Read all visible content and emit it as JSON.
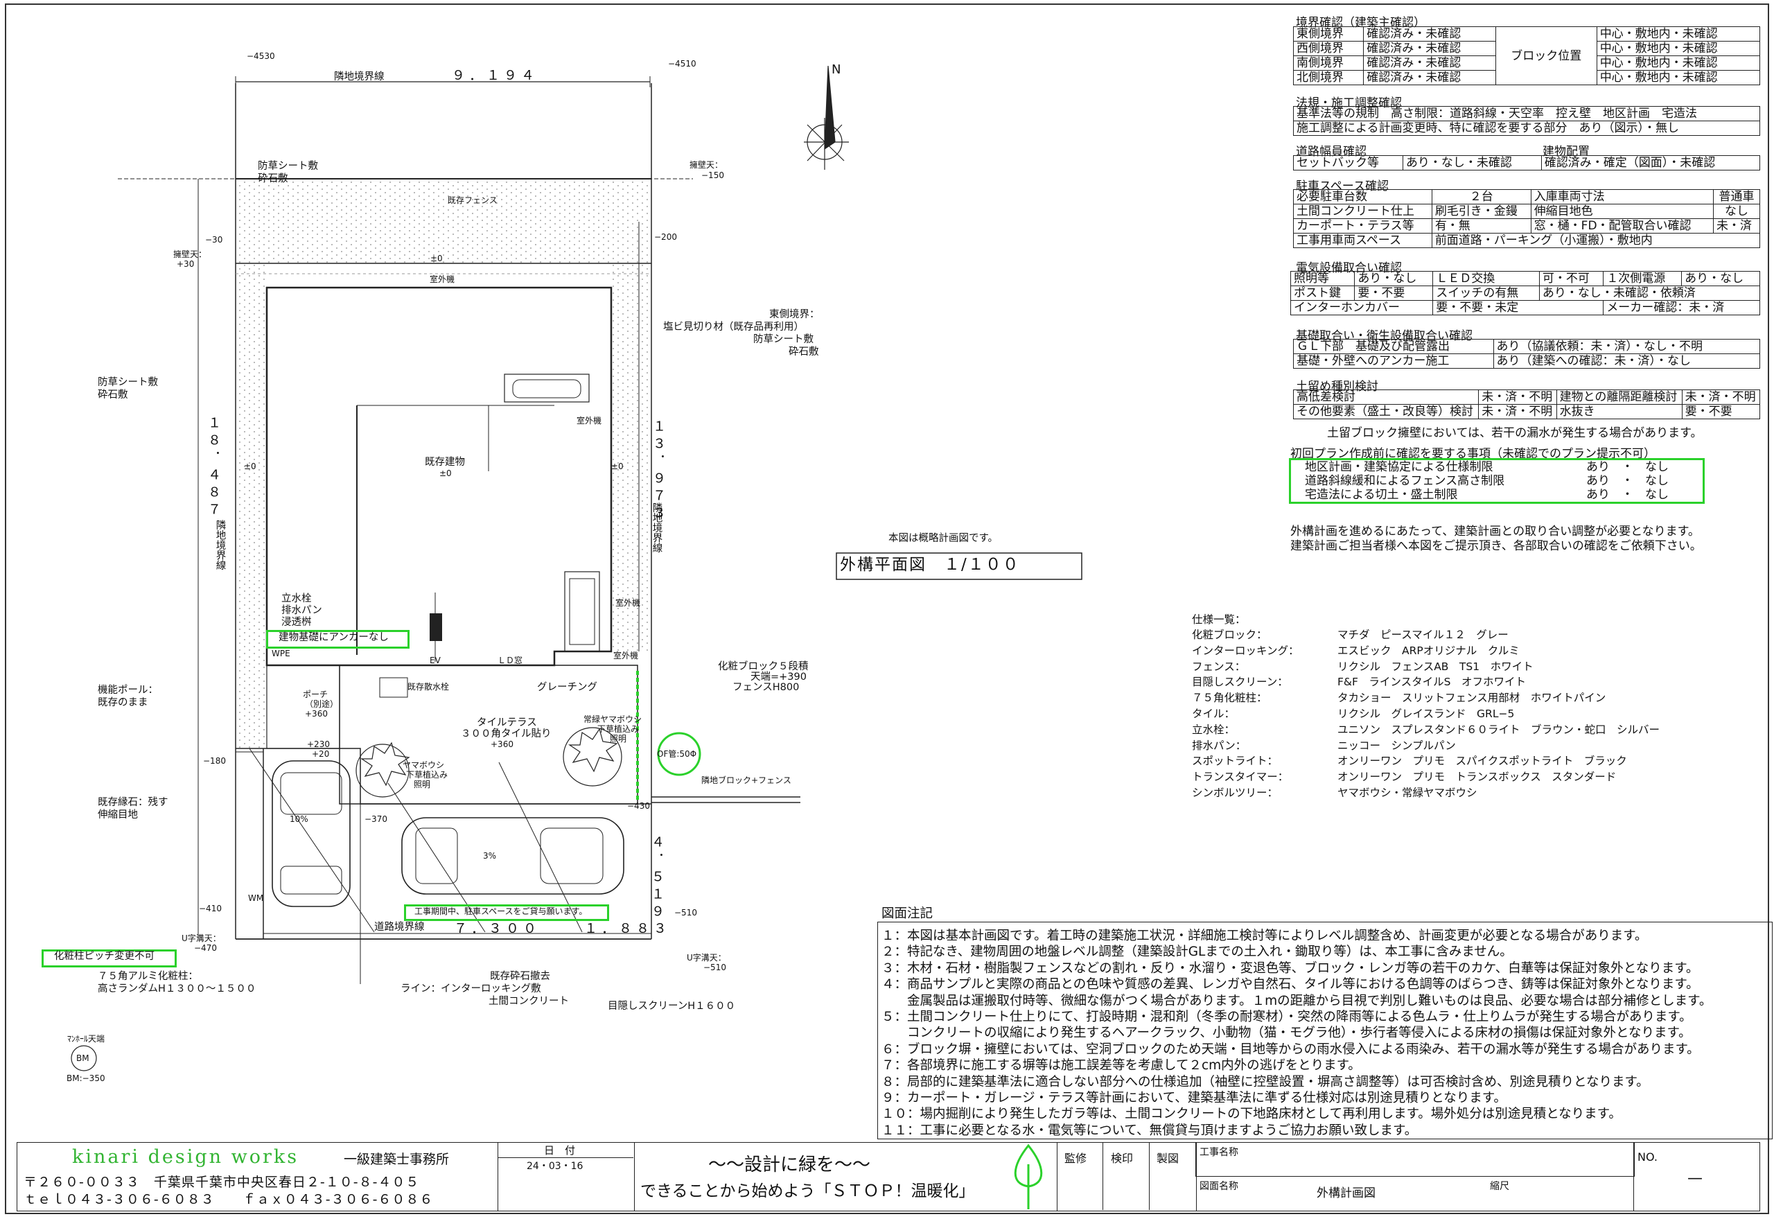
{
  "plan": {
    "top_left_level": "−4530",
    "top_right_level": "−4510",
    "north_label": "N",
    "top_boundary": "隣地境界線",
    "top_dim": "９．１９４",
    "gravel_top": [
      "防草シート敷",
      "砕石敷"
    ],
    "wall_label": [
      "擁壁天：",
      "−150"
    ],
    "existing_fence": "既存フェンス",
    "level_m30": "−30",
    "retaining_left": [
      "擁壁天：",
      "+30"
    ],
    "level_m200": "−200",
    "level_pm0": "±0",
    "outdoor_unit": "室外機",
    "east_boundary": [
      "東側境界：",
      "塩ビ見切り材（既存品再利用）",
      "防草シート敷",
      "砕石敷"
    ],
    "gravel_left": [
      "防草シート敷",
      "砕石敷"
    ],
    "left_dim": "１８．４８７",
    "right_dim": "１３．９７３",
    "left_boundary": "隣地境界線",
    "right_boundary": "隣地境界線",
    "house_name": "既存建物",
    "house_level": "±0",
    "water_tap": [
      "立水栓",
      "排水パン",
      "浸透桝"
    ],
    "anchor_note": "建物基礎にアンカーなし",
    "wpe": "WPE",
    "ev": "EV",
    "ld_window": "ＬＤ窓",
    "scatter_tap": "既存散水栓",
    "grating": "グレーチング",
    "makeup_block": [
      "化粧ブロック５段積",
      "天端=+390",
      "フェンスH800"
    ],
    "function_pole": [
      "機能ポール：",
      "既存のまま"
    ],
    "porch": [
      "ポーチ",
      "（別途）",
      "+360"
    ],
    "tile_terrace": [
      "タイルテラス",
      "３００角タイル貼り",
      "+360"
    ],
    "evergreen": [
      "常緑ヤマボウシ",
      "下草植込み",
      "照明"
    ],
    "yamaboushi": [
      "ヤマボウシ",
      "下草植込み",
      "照明"
    ],
    "of_pipe": "OF管:50Φ",
    "neighbor_block": "隣地ブロック+フェンス",
    "level_230": "+230",
    "level_20": "+20",
    "level_m180": "−180",
    "existing_curb": [
      "既存縁石：残す",
      "伸縮目地"
    ],
    "slope_10": "10%",
    "slope_3": "3%",
    "level_m370": "−370",
    "level_m430": "−430",
    "front_dim_right": "４．５１９",
    "wm": "WM",
    "level_m410": "−410",
    "level_m510": "−510",
    "parking_note": "工事期間中、駐車スペースをご貸与願います。",
    "road_boundary": "道路境界線",
    "front_dim_1": "７．３００",
    "front_dim_2": "１．８８３",
    "u_gutter_left": [
      "U字溝天：",
      "−470"
    ],
    "u_gutter_right": [
      "U字溝天：",
      "−510"
    ],
    "pillar_pitch": "化粧柱ピッチ変更不可",
    "pillar_spec": [
      "７５角アルミ化粧柱：",
      "高さランダムH１３００～１５００"
    ],
    "curb_remove": [
      "既存砕石撤去",
      "ライン：インターロッキング敷",
      "土間コンクリート"
    ],
    "screen_label": "目隠しスクリーンH１６００",
    "bm_title": "ﾏﾝﾎｰﾙ天端",
    "bm": "BM",
    "bm_level": "BM:−350"
  },
  "summary_note": "本図は概略計画図です。",
  "drawing_title": "外構平面図　１/１００",
  "checks": {
    "boundary_title": "境界確認（建築主確認）",
    "boundary_rows": [
      {
        "name": "東側境界",
        "status": "確認済み・未確認",
        "pos": "中心・敷地内・未確認"
      },
      {
        "name": "西側境界",
        "status": "確認済み・未確認",
        "pos": "中心・敷地内・未確認"
      },
      {
        "name": "南側境界",
        "status": "確認済み・未確認",
        "pos": "中心・敷地内・未確認"
      },
      {
        "name": "北側境界",
        "status": "確認済み・未確認",
        "pos": "中心・敷地内・未確認"
      }
    ],
    "block_pos": "ブロック位置",
    "law_title": "法規・施工調整確認",
    "law_rows": [
      "基準法等の規制　高さ制限：道路斜線・天空率　控え壁　地区計画　宅造法",
      "施工調整による計画変更時、特に確認を要する部分　あり（図示）・無し"
    ],
    "road_title": "道路幅員確認",
    "bldg_pos_title": "建物配置",
    "setback": "セットバック等",
    "setback_val": "あり・なし・未確認",
    "bldg_pos_val": "確認済み・確定（図面）・未確認",
    "parking_title": "駐車スペース確認",
    "parking_rows": [
      [
        "必要駐車台数",
        "２台",
        "入庫車両寸法",
        "普通車"
      ],
      [
        "土間コンクリート仕上",
        "刷毛引き・金鏝",
        "伸縮目地色",
        "なし"
      ],
      [
        "カーポート・テラス等",
        "有・無",
        "窓・樋・FD・配管取合い確認",
        "未・済"
      ],
      [
        "工事用車両スペース",
        "前面道路・パーキング（小運搬）・敷地内",
        "",
        ""
      ]
    ],
    "elec_title": "電気設備取合い確認",
    "elec_rows": [
      [
        "照明等",
        "あり・なし",
        "ＬＥＤ交換",
        "可・不可",
        "１次側電源",
        "あり・なし"
      ],
      [
        "ポスト鍵",
        "要・不要",
        "スイッチの有無",
        "あり・なし・未確認・依頼済",
        "",
        ""
      ],
      [
        "インターホンカバー",
        "要・不要・未定",
        "メーカー確認：未・済",
        "",
        "",
        ""
      ]
    ],
    "found_title": "基礎取合い・衛生設備取合い確認",
    "found_rows": [
      [
        "ＧＬ下部　基礎及び配管露出",
        "あり（協議依頼：未・済）・なし・不明"
      ],
      [
        "基礎・外壁へのアンカー施工",
        "あり（建築への確認：未・済）・なし"
      ]
    ],
    "soil_title": "土留め種別検討",
    "soil_rows": [
      [
        "高低差検討",
        "未・済・不明",
        "建物との離隔距離検討",
        "未・済・不明"
      ],
      [
        "その他要素（盛土・改良等）検討",
        "未・済・不明",
        "水抜き",
        "要・不要"
      ]
    ],
    "soil_note": "土留ブロック擁壁においては、若干の漏水が発生する場合があります。",
    "first_title": "初回プラン作成前に確認を要する事項（未確認でのプラン提示不可）",
    "first_rows": [
      [
        "地区計画・建築協定による仕様制限",
        "あり　・　なし"
      ],
      [
        "道路斜線緩和によるフェンス高さ制限",
        "あり　・　なし"
      ],
      [
        "宅造法による切土・盛土制限",
        "あり　・　なし"
      ]
    ],
    "adjust_note": [
      "外構計画を進めるにあたって、建築計画との取り合い調整が必要となります。",
      "建築計画ご担当者様へ本図をご提示頂き、各部取合いの確認をご依頼下さい。"
    ]
  },
  "specs": {
    "title": "仕様一覧：",
    "items": [
      [
        "化粧ブロック：",
        "マチダ　ピースマイル１２　グレー"
      ],
      [
        "インターロッキング：",
        "エスビック　ARPオリジナル　クルミ"
      ],
      [
        "フェンス：",
        "リクシル　フェンスAB　TS1　ホワイト"
      ],
      [
        "目隠しスクリーン：",
        "F&F　ラインスタイルS　オフホワイト"
      ],
      [
        "７５角化粧柱：",
        "タカショー　スリットフェンス用部材　ホワイトパイン"
      ],
      [
        "タイル：",
        "リクシル　グレイスランド　GRL−5"
      ],
      [
        "立水栓：",
        "ユニソン　スプレスタンド６０ライト　ブラウン・蛇口　シルバー"
      ],
      [
        "排水パン：",
        "ニッコー　シンプルパン"
      ],
      [
        "スポットライト：",
        "オンリーワン　プリモ　スパイクスポットライト　ブラック"
      ],
      [
        "トランスタイマー：",
        "オンリーワン　プリモ　トランスボックス　スタンダード"
      ],
      [
        "シンボルツリー：",
        "ヤマボウシ・常緑ヤマボウシ"
      ]
    ]
  },
  "notes": {
    "title": "図面注記",
    "lines": [
      "１：本図は基本計画図です。着工時の建築施工状況・詳細施工検討等によりレベル調整含め、計画変更が必要となる場合があります。",
      "２：特記なき、建物周囲の地盤レベル調整（建築設計GLまでの土入れ・鋤取り等）は、本工事に含みません。",
      "３：木材・石材・樹脂製フェンスなどの割れ・反り・水溜り・変退色等、ブロック・レンガ等の若干のカケ、白華等は保証対象外となります。",
      "４：商品サンプルと実際の商品との色味や質感の差異、レンガや自然石、タイル等における色調等のばらつき、鋳等は保証対象外となります。",
      "　　金属製品は運搬取付時等、微細な傷がつく場合があります。１mの距離から目視で判別し難いものは良品、必要な場合は部分補修とします。",
      "５：土間コンクリート仕上りにて、打設時期・混和剤（冬季の耐寒材）・突然の降雨等による色ムラ・仕上りムラが発生する場合があります。",
      "　　コンクリートの収縮により発生するヘアークラック、小動物（猫・モグラ他）・歩行者等侵入による床材の損傷は保証対象外となります。",
      "６：ブロック塀・擁壁においては、空洞ブロックのため天端・目地等からの雨水侵入による雨染み、若干の漏水等が発生する場合があります。",
      "７：各部境界に施工する塀等は施工誤差等を考慮して２cm内外の逃げをとります。",
      "８：局部的に建築基準法に適合しない部分への仕様追加（袖壁に控壁設置・塀高さ調整等）は可否検討含め、別途見積りとなります。",
      "９：カーポート・ガレージ・テラス等計画において、建築基準法に準ずる仕様対応は別途見積りとなります。",
      "１０：場内掘削により発生したガラ等は、土間コンクリートの下地路床材として再利用します。場外処分は別途見積となります。",
      "１１：工事に必要となる水・電気等について、無償貸与頂けますようご協力お願い致します。"
    ]
  },
  "titleblock": {
    "company": "kinari design works",
    "office_type": "一級建築士事務所",
    "address": "〒２６０-００３３　千葉県千葉市中央区春日２-１０-８-４０５",
    "contact": "ｔｅｌ０４３-３０６-６０８３　　ｆａｘ０４３-３０６-６０８６",
    "date_label": "日　付",
    "date": "24・03・16",
    "slogan1": "～～設計に緑を～～",
    "slogan2": "できることから始めよう「ＳＴＯＰ！温暖化」",
    "kanshu": "監修",
    "kennin": "検印",
    "seizu": "製図",
    "project_label": "工事名称",
    "drawing_label": "図面名称",
    "drawing_name": "外構計画図",
    "scale_label": "縮尺",
    "no_label": "NO.",
    "no_value": "—"
  },
  "colors": {
    "accent": "#2bd12b",
    "ink": "#222222",
    "logo": "#32b432"
  }
}
